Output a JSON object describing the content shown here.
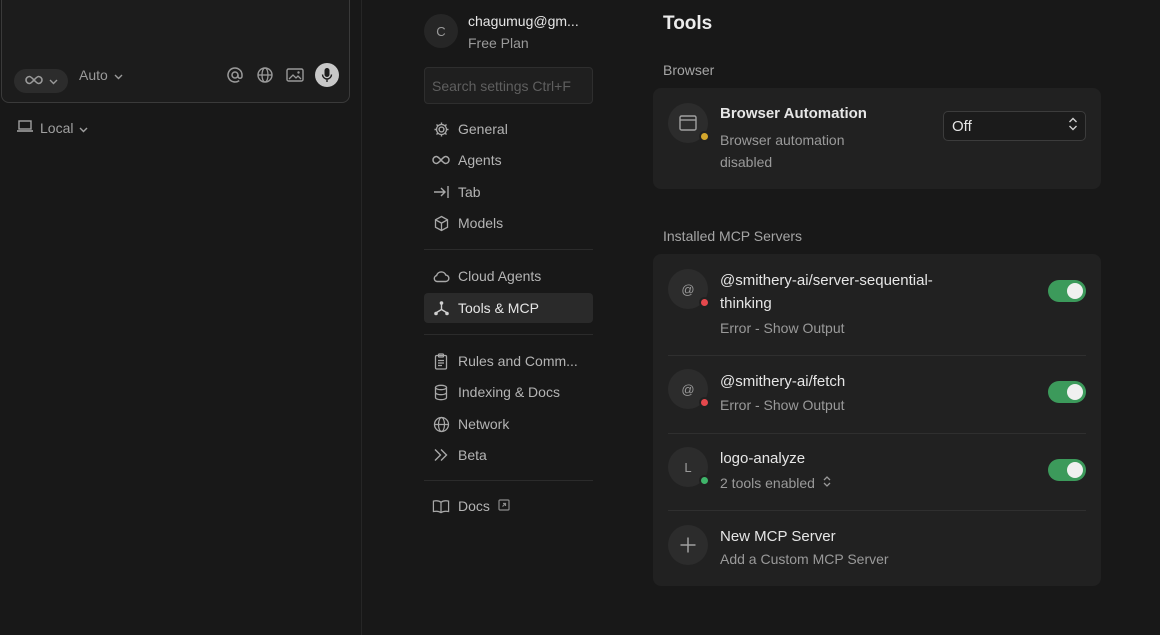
{
  "composer": {
    "mode_icon": "infinity-icon",
    "model_label": "Auto",
    "icons": [
      "at-icon",
      "globe-icon",
      "image-icon",
      "mic-icon"
    ]
  },
  "workspace": {
    "label": "Local",
    "icon": "laptop-icon"
  },
  "account": {
    "avatar_initial": "C",
    "email": "chagumug@gm...",
    "plan": "Free Plan"
  },
  "search": {
    "placeholder": "Search settings Ctrl+F"
  },
  "nav": {
    "general": "General",
    "agents": "Agents",
    "tab": "Tab",
    "models": "Models",
    "cloud_agents": "Cloud Agents",
    "tools_mcp": "Tools & MCP",
    "rules": "Rules and Comm...",
    "indexing": "Indexing & Docs",
    "network": "Network",
    "beta": "Beta",
    "docs": "Docs"
  },
  "main": {
    "title": "Tools",
    "browser_section": "Browser",
    "browser": {
      "title": "Browser Automation",
      "sub_line1": "Browser automation",
      "sub_line2": "disabled",
      "status_color": "#d4a72c",
      "select_value": "Off"
    },
    "mcp_section": "Installed MCP Servers",
    "servers": [
      {
        "initial": "@",
        "title_line1": "@smithery-ai/server-sequential-",
        "title_line2": "thinking",
        "status": "Error - Show Output",
        "status_color": "#e5484d",
        "enabled": true
      },
      {
        "initial": "@",
        "title_line1": "@smithery-ai/fetch",
        "status": "Error - Show Output",
        "status_color": "#e5484d",
        "enabled": true
      },
      {
        "initial": "L",
        "title_line1": "logo-analyze",
        "status": "2 tools enabled",
        "status_color": "#3fb56a",
        "enabled": true
      }
    ],
    "new_server": {
      "title": "New MCP Server",
      "sub": "Add a Custom MCP Server"
    }
  },
  "colors": {
    "accent_toggle": "#3c9a5b",
    "background": "#181818",
    "card": "#212121"
  }
}
